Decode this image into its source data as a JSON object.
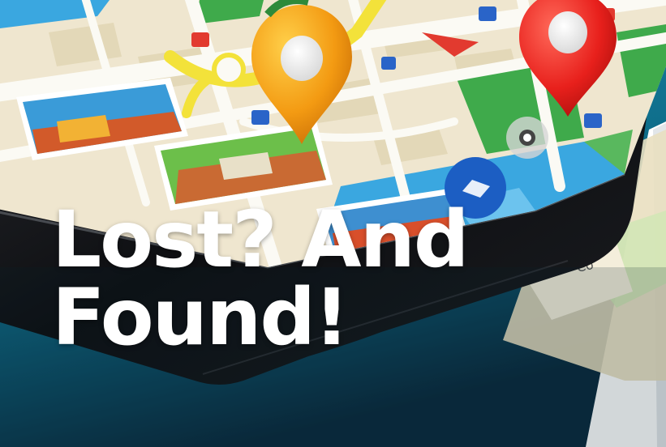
{
  "banner": {
    "headline_line1": "Lost? And",
    "headline_line2": "Found!",
    "image": {
      "icon": "map-phone-illustration",
      "pins": [
        "orange-location-pin-icon",
        "red-location-pin-icon"
      ]
    }
  },
  "colors": {
    "background_teal": "#0f6f8c",
    "background_dark": "#0a2a3d",
    "map_beige": "#efe6cf",
    "road_white": "#fbfaf4",
    "park_green": "#3faa4b",
    "water_blue": "#3aa7e0",
    "pin_orange": "#f39a12",
    "pin_red": "#e8201c",
    "phone_black": "#101114",
    "headline_text": "#ffffff"
  }
}
